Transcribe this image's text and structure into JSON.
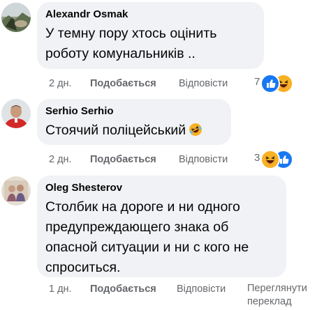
{
  "comments": [
    {
      "author": "Alexandr Osmak",
      "text": "У темну пору хтось оцінить роботу комунальників ..",
      "time": "2 дн.",
      "like_label": "Подобається",
      "reply_label": "Відповісти",
      "reaction_count": "7",
      "reactions": [
        "like-reaction-icon",
        "haha-reaction-icon"
      ]
    },
    {
      "author": "Serhio Serhio",
      "text": "Стоячий поліцейський",
      "emoji": "rofl-emoji-icon",
      "time": "2 дн.",
      "like_label": "Подобається",
      "reply_label": "Відповісти",
      "reaction_count": "3",
      "reactions": [
        "haha-reaction-icon",
        "like-reaction-icon"
      ]
    },
    {
      "author": "Oleg Shesterov",
      "text": "Столбик на дороге и ни одного предупреждающего знака об опасной ситуации и ни с кого не спроситься.",
      "time": "1 дн.",
      "like_label": "Подобається",
      "reply_label": "Відповісти",
      "translate_label": "Переглянути переклад"
    }
  ],
  "colors": {
    "bubble": "#f0f2f5",
    "meta_text": "#65676b",
    "like_blue": "#1877f2",
    "haha_yellow": "#f7b125"
  }
}
